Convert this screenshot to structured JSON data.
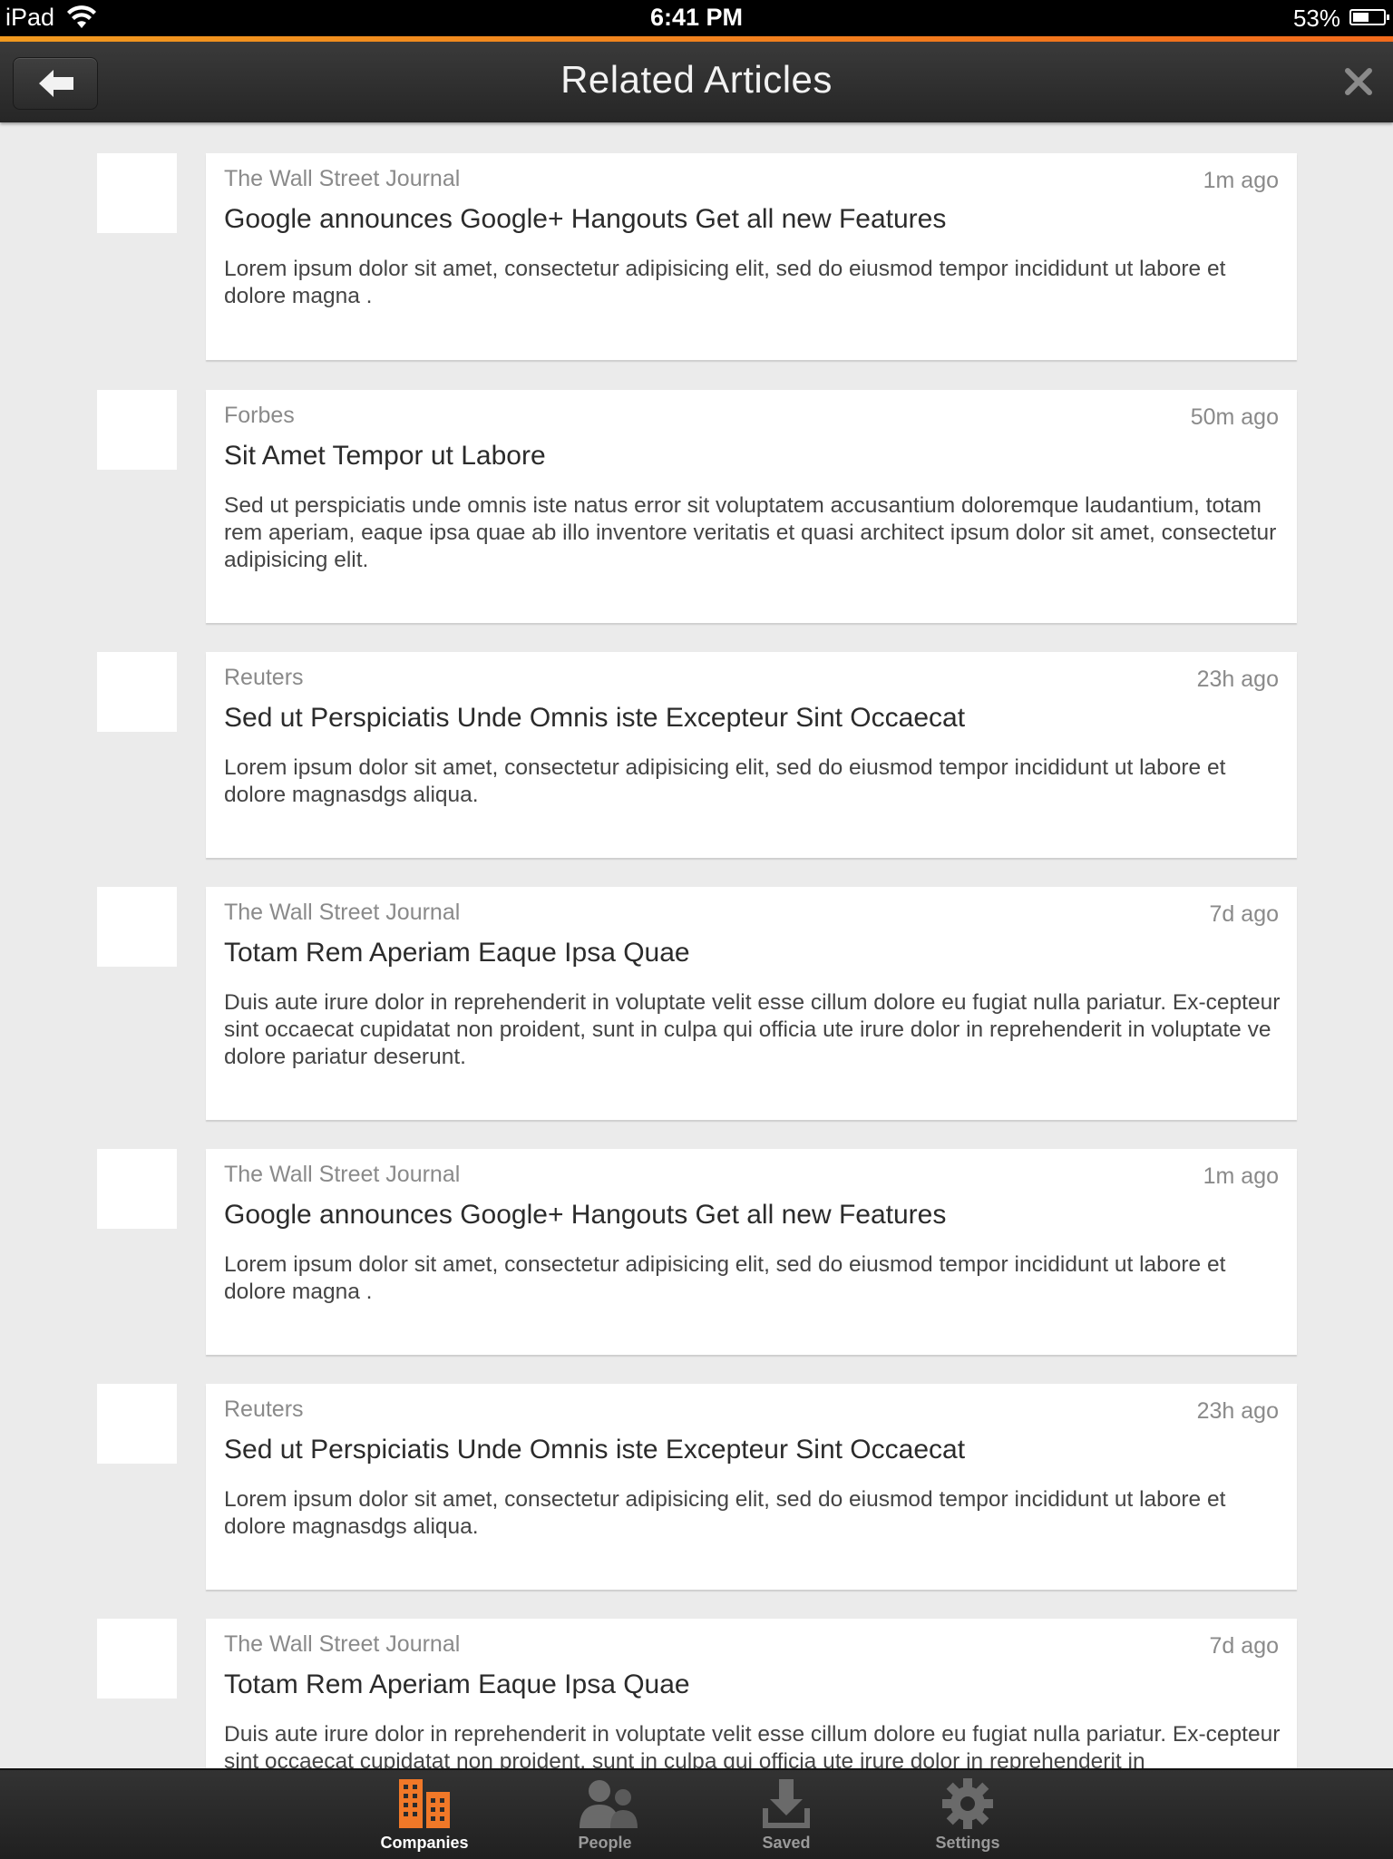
{
  "status_bar": {
    "device": "iPad",
    "time": "6:41 PM",
    "battery": "53%",
    "battery_level": 0.53
  },
  "nav": {
    "title": "Related Articles"
  },
  "colors": {
    "accent_start": "#f29a1f",
    "accent_end": "#f36b1c",
    "tab_active": "#f07828"
  },
  "articles": [
    {
      "source": "The Wall Street Journal",
      "time": "1m ago",
      "headline": "Google announces Google+ Hangouts Get all new Features",
      "summary": "Lorem ipsum dolor sit amet, consectetur adipisicing elit, sed do eiusmod tempor incididunt ut labore et dolore magna ."
    },
    {
      "source": "Forbes",
      "time": "50m ago",
      "headline": "Sit Amet Tempor ut Labore",
      "summary": "Sed ut perspiciatis unde omnis iste natus error sit voluptatem accusantium doloremque laudantium, totam rem aperiam, eaque ipsa quae ab illo inventore veritatis et quasi architect ipsum dolor sit amet, consectetur adipisicing elit."
    },
    {
      "source": "Reuters",
      "time": "23h ago",
      "headline": "Sed ut Perspiciatis Unde Omnis iste Excepteur Sint Occaecat",
      "summary": "Lorem ipsum dolor sit amet, consectetur adipisicing elit, sed do eiusmod tempor incididunt ut labore et dolore magnasdgs aliqua."
    },
    {
      "source": "The Wall Street Journal",
      "time": "7d ago",
      "headline": "Totam Rem Aperiam Eaque Ipsa Quae",
      "summary": "Duis aute irure dolor in reprehenderit in voluptate velit esse cillum dolore eu fugiat nulla pariatur. Ex-cepteur sint occaecat cupidatat non proident, sunt in culpa qui officia ute irure dolor in reprehenderit in voluptate ve dolore pariatur deserunt."
    },
    {
      "source": "The Wall Street Journal",
      "time": "1m ago",
      "headline": "Google announces Google+ Hangouts Get all new Features",
      "summary": "Lorem ipsum dolor sit amet, consectetur adipisicing elit, sed do eiusmod tempor incididunt ut labore et dolore magna ."
    },
    {
      "source": "Reuters",
      "time": "23h ago",
      "headline": "Sed ut Perspiciatis Unde Omnis iste Excepteur Sint Occaecat",
      "summary": "Lorem ipsum dolor sit amet, consectetur adipisicing elit, sed do eiusmod tempor incididunt ut labore et dolore magnasdgs aliqua."
    },
    {
      "source": "The Wall Street Journal",
      "time": "7d ago",
      "headline": "Totam Rem Aperiam Eaque Ipsa Quae",
      "summary": "Duis aute irure dolor in reprehenderit in voluptate velit esse cillum dolore eu fugiat nulla pariatur. Ex-cepteur sint occaecat cupidatat non proident, sunt in culpa qui officia ute irure dolor in reprehenderit in"
    }
  ],
  "tabs": [
    {
      "label": "Companies",
      "icon": "companies-icon",
      "active": true
    },
    {
      "label": "People",
      "icon": "people-icon",
      "active": false
    },
    {
      "label": "Saved",
      "icon": "saved-icon",
      "active": false
    },
    {
      "label": "Settings",
      "icon": "gear-icon",
      "active": false
    }
  ]
}
